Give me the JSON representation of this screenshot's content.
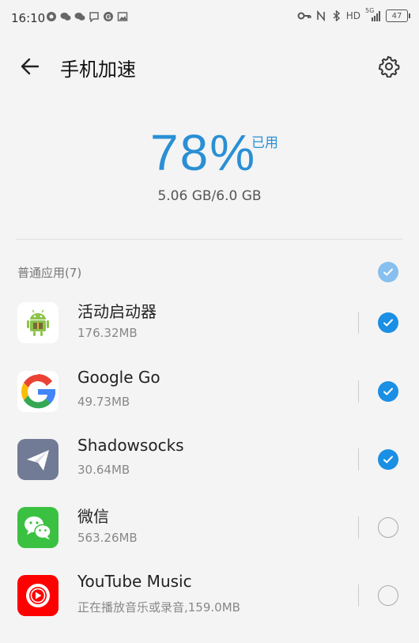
{
  "status_bar": {
    "time": "16:10",
    "network": "HD",
    "signal_label": "5G",
    "battery": "47"
  },
  "header": {
    "title": "手机加速"
  },
  "usage": {
    "percent": "78%",
    "used_label": "已用",
    "memory": "5.06 GB/6.0 GB"
  },
  "section": {
    "label": "普通应用(7)",
    "checked": true
  },
  "apps": [
    {
      "name": "活动启动器",
      "size": "176.32MB",
      "checked": true,
      "icon": "android-robot-icon"
    },
    {
      "name": "Google Go",
      "size": "49.73MB",
      "checked": true,
      "icon": "google-g-icon"
    },
    {
      "name": "Shadowsocks",
      "size": "30.64MB",
      "checked": true,
      "icon": "paper-plane-icon"
    },
    {
      "name": "微信",
      "size": "563.26MB",
      "checked": false,
      "icon": "wechat-icon"
    },
    {
      "name": "YouTube Music",
      "size": "正在播放音乐或录音,159.0MB",
      "checked": false,
      "icon": "youtube-music-icon"
    }
  ],
  "colors": {
    "accent": "#1a8fe3",
    "percent_text": "#2a8fd4"
  }
}
